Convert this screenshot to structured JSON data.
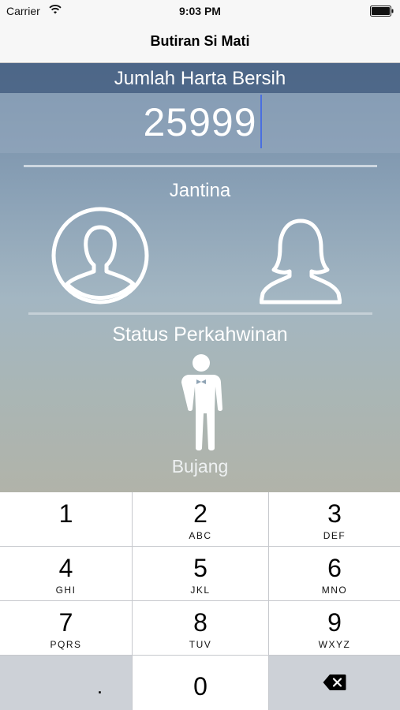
{
  "status_bar": {
    "carrier": "Carrier",
    "time": "9:03 PM",
    "wifi_icon": "wifi-icon",
    "battery_icon": "battery-icon"
  },
  "nav": {
    "title": "Butiran Si Mati"
  },
  "form": {
    "net_assets_label": "Jumlah Harta Bersih",
    "net_assets_value": "25999",
    "gender_label": "Jantina",
    "gender_options": [
      {
        "icon": "male-avatar-icon",
        "selected": true
      },
      {
        "icon": "female-avatar-icon",
        "selected": false
      }
    ],
    "marital_status_label": "Status Perkahwinan",
    "marital_status_icon": "groom-icon",
    "marital_status_value": "Bujang"
  },
  "keypad": {
    "keys": [
      {
        "digit": "1",
        "letters": ""
      },
      {
        "digit": "2",
        "letters": "ABC"
      },
      {
        "digit": "3",
        "letters": "DEF"
      },
      {
        "digit": "4",
        "letters": "GHI"
      },
      {
        "digit": "5",
        "letters": "JKL"
      },
      {
        "digit": "6",
        "letters": "MNO"
      },
      {
        "digit": "7",
        "letters": "PQRS"
      },
      {
        "digit": "8",
        "letters": "TUV"
      },
      {
        "digit": "9",
        "letters": "WXYZ"
      }
    ],
    "decimal": ".",
    "zero": "0",
    "delete_icon": "backspace-icon"
  },
  "colors": {
    "header_band": "#3e587c",
    "cursor": "#4a6fe0",
    "keypad_bg": "#c9ccd2"
  }
}
